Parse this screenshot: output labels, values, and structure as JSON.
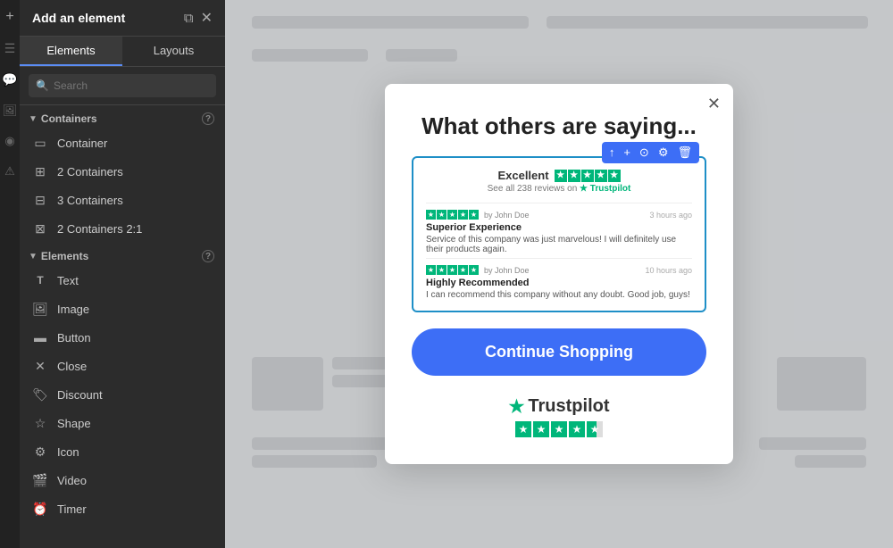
{
  "sidebar": {
    "title": "Add an element",
    "tabs": [
      {
        "label": "Elements",
        "active": true
      },
      {
        "label": "Layouts",
        "active": false
      }
    ],
    "search_placeholder": "Search",
    "containers_section": "Containers",
    "elements_section": "Elements",
    "containers": [
      {
        "label": "Container"
      },
      {
        "label": "2 Containers"
      },
      {
        "label": "3 Containers"
      },
      {
        "label": "2 Containers 2:1"
      }
    ],
    "elements": [
      {
        "label": "Text"
      },
      {
        "label": "Image"
      },
      {
        "label": "Button"
      },
      {
        "label": "Close"
      },
      {
        "label": "Discount"
      },
      {
        "label": "Shape"
      },
      {
        "label": "Icon"
      },
      {
        "label": "Video"
      },
      {
        "label": "Timer"
      }
    ]
  },
  "modal": {
    "title": "What others are saying...",
    "trustpilot_label": "Excellent",
    "trustpilot_review_count": "See all 238 reviews on",
    "trustpilot_brand": "Trustpilot",
    "reviews": [
      {
        "reviewer": "by John Doe",
        "time": "3 hours ago",
        "title": "Superior Experience",
        "text": "Service of this company was just marvelous! I will definitely use their products again."
      },
      {
        "reviewer": "by John Doe",
        "time": "10 hours ago",
        "title": "Highly Recommended",
        "text": "I can recommend this company without any doubt. Good job, guys!"
      }
    ],
    "continue_button": "Continue Shopping",
    "footer_logo": "Trustpilot"
  },
  "toolbar_icons": [
    "↑",
    "+",
    "⊙",
    "⚙",
    "🗑"
  ]
}
